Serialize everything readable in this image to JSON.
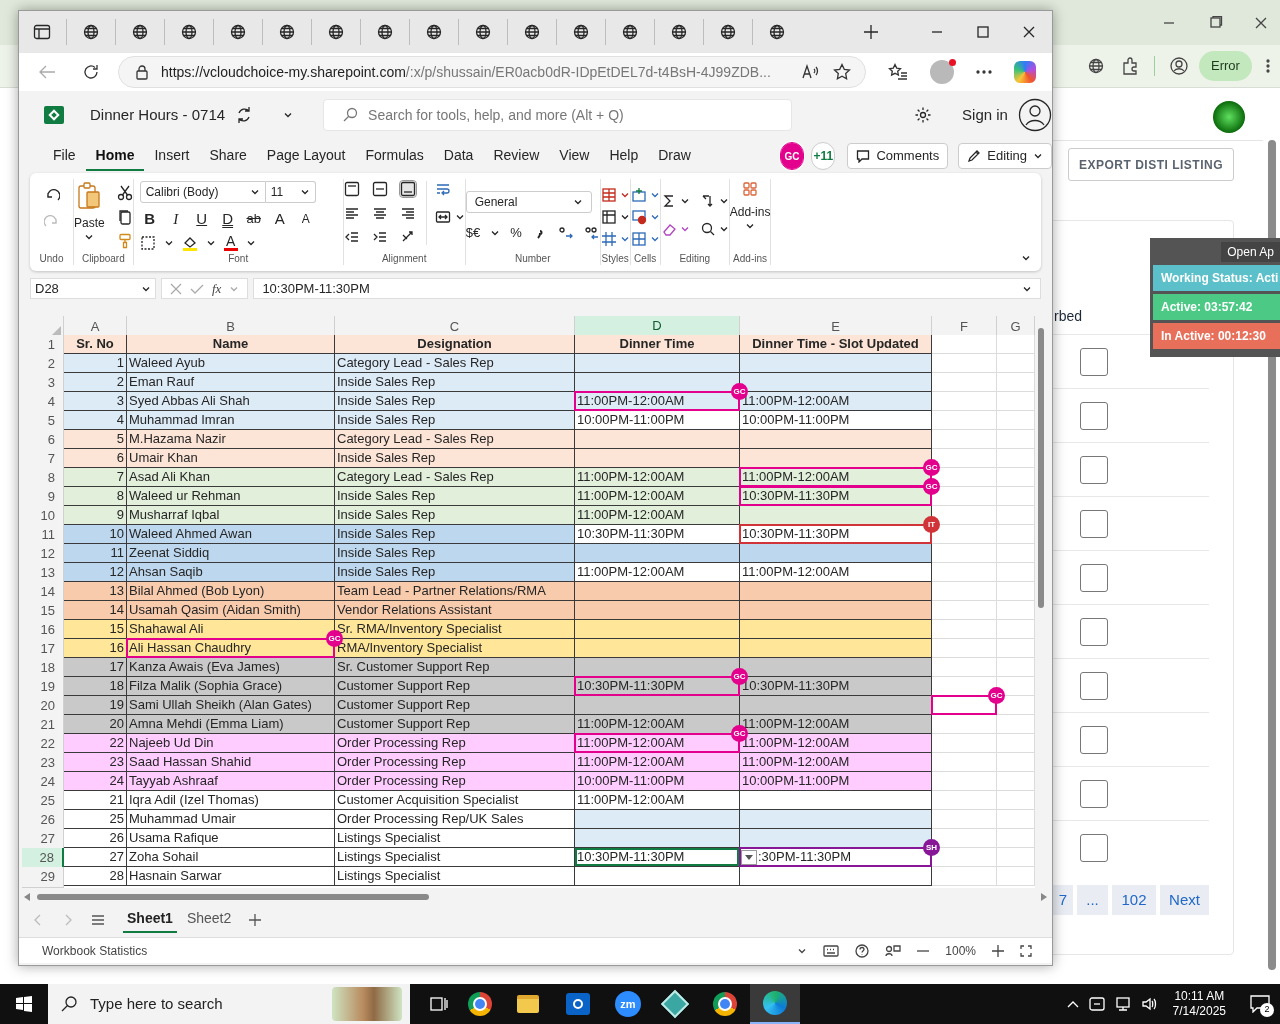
{
  "background_browser": {
    "profile_button": "Error",
    "export_button": "EXPORT DISTI LISTING",
    "column_header": "rbed",
    "checkboxes": [
      {
        "checked": false
      },
      {
        "checked": false
      },
      {
        "checked": false
      },
      {
        "checked": false
      },
      {
        "checked": false
      },
      {
        "checked": false
      },
      {
        "checked": false
      },
      {
        "checked": false
      },
      {
        "checked": false
      },
      {
        "checked": false
      }
    ],
    "pagination": [
      "7",
      "...",
      "102",
      "Next"
    ]
  },
  "status_widget": {
    "title": "Open Ap",
    "items": [
      {
        "text": "Working Status: Acti",
        "color": "#5bc0c9"
      },
      {
        "text": "Active: 03:57:42",
        "color": "#4cc985"
      },
      {
        "text": "In Active: 00:12:30",
        "color": "#e8705a"
      }
    ]
  },
  "edge_window": {
    "tabs": [
      {
        "kind": "page"
      },
      {
        "kind": "page"
      },
      {
        "kind": "page"
      },
      {
        "kind": "page"
      },
      {
        "kind": "page"
      },
      {
        "kind": "page"
      },
      {
        "kind": "page"
      },
      {
        "kind": "page"
      },
      {
        "kind": "page"
      },
      {
        "kind": "page"
      },
      {
        "kind": "page"
      },
      {
        "kind": "page"
      },
      {
        "kind": "page"
      },
      {
        "kind": "page"
      },
      {
        "kind": "page"
      }
    ],
    "address": {
      "host": "https://vcloudchoice-my.sharepoint.com",
      "path": "/:x/p/shussain/ER0acb0dR-IDpEtDEL7d-t4BsH-4J99ZDB..."
    }
  },
  "excel": {
    "title": "Dinner Hours - 0714",
    "search_placeholder": "Search for tools, help, and more (Alt + Q)",
    "sign_in": "Sign in",
    "menu": [
      {
        "label": "File",
        "selected": false
      },
      {
        "label": "Home",
        "selected": true
      },
      {
        "label": "Insert",
        "selected": false
      },
      {
        "label": "Share",
        "selected": false
      },
      {
        "label": "Page Layout",
        "selected": false
      },
      {
        "label": "Formulas",
        "selected": false
      },
      {
        "label": "Data",
        "selected": false
      },
      {
        "label": "Review",
        "selected": false
      },
      {
        "label": "View",
        "selected": false
      },
      {
        "label": "Help",
        "selected": false
      },
      {
        "label": "Draw",
        "selected": false
      }
    ],
    "collaborator": {
      "initials": "GC",
      "color": "#e3008c"
    },
    "more_collaborators": "+11",
    "comments": "Comments",
    "mode": "Editing",
    "ribbon": {
      "paste": "Paste",
      "font": "Calibri (Body)",
      "size": "11",
      "font_buttons": [
        "B",
        "I",
        "U",
        "D",
        "ab",
        "A",
        "A"
      ],
      "font_color": "A",
      "number_format": "General",
      "currency": "$€",
      "percent": "%",
      "addins": "Add-ins",
      "groups": [
        "Undo",
        "Clipboard",
        "Font",
        "Alignment",
        "Number",
        "Styles",
        "Cells",
        "Editing",
        "Add-ins"
      ]
    },
    "formula_bar": {
      "name_box": "D28",
      "function_label": "fx",
      "value": "10:30PM-11:30PM"
    },
    "columns": [
      {
        "label": "A",
        "selected": false
      },
      {
        "label": "B",
        "selected": false
      },
      {
        "label": "C",
        "selected": false
      },
      {
        "label": "D",
        "selected": true
      },
      {
        "label": "E",
        "selected": false
      },
      {
        "label": "F",
        "selected": false
      },
      {
        "label": "G",
        "selected": false
      }
    ],
    "rows": [
      {
        "n": "1",
        "kind": "header",
        "selected": false,
        "sr": "Sr. No",
        "name": "Name",
        "designation": "Designation",
        "dinner_time": "Dinner Time",
        "slot_updated": "Dinner Time - Slot Updated",
        "color": "#fce4d6",
        "time_fill": {
          "color": "#fce4d6"
        }
      },
      {
        "n": "2",
        "kind": "data",
        "selected": false,
        "sr": "1",
        "name": "Waleed Ayub",
        "designation": "Category Lead - Sales Rep",
        "color": "#ddebf7",
        "time_fill": {
          "color": "#ddebf7"
        }
      },
      {
        "n": "3",
        "kind": "data",
        "selected": false,
        "sr": "2",
        "name": "Eman Rauf",
        "designation": "Inside Sales Rep",
        "color": "#ddebf7",
        "time_fill": {
          "color": "#ddebf7"
        }
      },
      {
        "n": "4",
        "kind": "data",
        "selected": false,
        "sr": "3",
        "name": "Syed Abbas Ali Shah",
        "designation": "Inside Sales Rep",
        "dinner_time": "11:00PM-12:00AM",
        "slot_updated": "11:00PM-12:00AM",
        "color": "#ddebf7",
        "time_fill": {
          "color": "#ddebf7"
        },
        "dinner_time_marker": {
          "initials": "GC",
          "color": "#e3008c"
        }
      },
      {
        "n": "5",
        "kind": "data",
        "selected": false,
        "sr": "4",
        "name": "Muhammad Imran",
        "designation": "Inside Sales Rep",
        "dinner_time": "10:00PM-11:00PM",
        "slot_updated": "10:00PM-11:00PM",
        "color": "#ddebf7"
      },
      {
        "n": "6",
        "kind": "data",
        "selected": false,
        "sr": "5",
        "name": "M.Hazama Nazir",
        "designation": "Category Lead - Sales Rep",
        "color": "#fce4d6",
        "time_fill": {
          "color": "#fce4d6"
        }
      },
      {
        "n": "7",
        "kind": "data",
        "selected": false,
        "sr": "6",
        "name": "Umair Khan",
        "designation": "Inside Sales Rep",
        "color": "#fce4d6",
        "time_fill": {
          "color": "#fce4d6"
        }
      },
      {
        "n": "8",
        "kind": "data",
        "selected": false,
        "sr": "7",
        "name": "Asad Ali Khan",
        "designation": "Category Lead - Sales Rep",
        "dinner_time": "11:00PM-12:00AM",
        "slot_updated": "11:00PM-12:00AM",
        "color": "#e2efda",
        "time_fill": {
          "color": "#e2efda"
        },
        "slot_updated_marker": {
          "initials": "GC",
          "color": "#e3008c"
        }
      },
      {
        "n": "9",
        "kind": "data",
        "selected": false,
        "sr": "8",
        "name": "Waleed ur Rehman",
        "designation": "Inside Sales Rep",
        "dinner_time": "11:00PM-12:00AM",
        "slot_updated": "10:30PM-11:30PM",
        "color": "#e2efda",
        "time_fill": {
          "color": "#e2efda"
        },
        "slot_updated_marker": {
          "initials": "GC",
          "color": "#e3008c"
        }
      },
      {
        "n": "10",
        "kind": "data",
        "selected": false,
        "sr": "9",
        "name": "Musharraf Iqbal",
        "designation": "Inside Sales Rep",
        "dinner_time": "11:00PM-12:00AM",
        "color": "#e2efda",
        "time_fill": {
          "color": "#e2efda"
        }
      },
      {
        "n": "11",
        "kind": "data",
        "selected": false,
        "sr": "10",
        "name": "Waleed Ahmed Awan",
        "designation": "Inside Sales Rep",
        "dinner_time": "10:30PM-11:30PM",
        "slot_updated": "10:30PM-11:30PM",
        "color": "#bdd7ee",
        "slot_updated_marker": {
          "initials": "IT",
          "color": "#d13438"
        }
      },
      {
        "n": "12",
        "kind": "data",
        "selected": false,
        "sr": "11",
        "name": "Zeenat Siddiq",
        "designation": "Inside Sales Rep",
        "color": "#bdd7ee",
        "time_fill": {
          "color": "#bdd7ee"
        }
      },
      {
        "n": "13",
        "kind": "data",
        "selected": false,
        "sr": "12",
        "name": "Ahsan Saqib",
        "designation": "Inside Sales Rep",
        "dinner_time": "11:00PM-12:00AM",
        "slot_updated": "11:00PM-12:00AM",
        "color": "#bdd7ee"
      },
      {
        "n": "14",
        "kind": "data",
        "selected": false,
        "sr": "13",
        "name": "Bilal Ahmed (Bob Lyon)",
        "designation": "Team Lead - Partner Relations/RMA",
        "color": "#f8cbad",
        "time_fill": {
          "color": "#f8cbad"
        }
      },
      {
        "n": "15",
        "kind": "data",
        "selected": false,
        "sr": "14",
        "name": "Usamah Qasim (Aidan Smith)",
        "designation": "Vendor Relations Assistant",
        "color": "#f8cbad",
        "time_fill": {
          "color": "#f8cbad"
        }
      },
      {
        "n": "16",
        "kind": "data",
        "selected": false,
        "sr": "15",
        "name": "Shahawal Ali",
        "designation": "Sr. RMA/Inventory Specialist",
        "color": "#ffe699",
        "time_fill": {
          "color": "#ffe699"
        }
      },
      {
        "n": "17",
        "kind": "data",
        "selected": false,
        "sr": "16",
        "name": "Ali Hassan Chaudhry",
        "designation": "RMA/Inventory Specialist",
        "color": "#ffe699",
        "time_fill": {
          "color": "#ffe699"
        },
        "name_marker": {
          "initials": "GC",
          "color": "#e3008c"
        }
      },
      {
        "n": "18",
        "kind": "data",
        "selected": false,
        "sr": "17",
        "name": "Kanza Awais (Eva James)",
        "designation": "Sr. Customer Support Rep",
        "color": "#c9c9c9",
        "time_fill": {
          "color": "#c9c9c9"
        }
      },
      {
        "n": "19",
        "kind": "data",
        "selected": false,
        "sr": "18",
        "name": "Filza Malik (Sophia Grace)",
        "designation": "Customer Support Rep",
        "dinner_time": "10:30PM-11:30PM",
        "slot_updated": "10:30PM-11:30PM",
        "color": "#c9c9c9",
        "time_fill": {
          "color": "#c9c9c9"
        },
        "dinner_time_marker": {
          "initials": "GC",
          "color": "#e3008c"
        }
      },
      {
        "n": "20",
        "kind": "data",
        "selected": false,
        "sr": "19",
        "name": "Sami Ullah Sheikh (Alan Gates)",
        "designation": "Customer Support Rep",
        "color": "#c9c9c9",
        "time_fill": {
          "color": "#c9c9c9"
        },
        "column_f_marker": {
          "initials": "GC",
          "color": "#e3008c"
        }
      },
      {
        "n": "21",
        "kind": "data",
        "selected": false,
        "sr": "20",
        "name": "Amna Mehdi (Emma Liam)",
        "designation": "Customer Support Rep",
        "dinner_time": "11:00PM-12:00AM",
        "slot_updated": "11:00PM-12:00AM",
        "color": "#c9c9c9",
        "time_fill": {
          "color": "#c9c9c9"
        }
      },
      {
        "n": "22",
        "kind": "data",
        "selected": false,
        "sr": "22",
        "name": "Najeeb Ud Din",
        "designation": "Order Processing Rep",
        "dinner_time": "11:00PM-12:00AM",
        "slot_updated": "11:00PM-12:00AM",
        "color": "#ffccff",
        "time_fill": {
          "color": "#ffccff"
        },
        "dinner_time_marker": {
          "initials": "GC",
          "color": "#e3008c"
        }
      },
      {
        "n": "23",
        "kind": "data",
        "selected": false,
        "sr": "23",
        "name": "Saad Hassan Shahid",
        "designation": "Order Processing Rep",
        "dinner_time": "11:00PM-12:00AM",
        "slot_updated": "11:00PM-12:00AM",
        "color": "#ffccff",
        "time_fill": {
          "color": "#ffccff"
        }
      },
      {
        "n": "24",
        "kind": "data",
        "selected": false,
        "sr": "24",
        "name": "Tayyab Ashraaf",
        "designation": "Order Processing Rep",
        "dinner_time": "10:00PM-11:00PM",
        "slot_updated": "10:00PM-11:00PM",
        "color": "#ffccff",
        "time_fill": {
          "color": "#ffccff"
        }
      },
      {
        "n": "25",
        "kind": "data",
        "selected": false,
        "sr": "21",
        "name": "Iqra Adil (Izel Thomas)",
        "designation": "Customer Acquisition Specialist",
        "dinner_time": "11:00PM-12:00AM"
      },
      {
        "n": "26",
        "kind": "data",
        "selected": false,
        "sr": "25",
        "name": "Muhammad Umair",
        "designation": "Order Processing Rep/UK Sales",
        "time_fill": {
          "color": "#ddebf7"
        }
      },
      {
        "n": "27",
        "kind": "data",
        "selected": false,
        "sr": "26",
        "name": "Usama Rafique",
        "designation": "Listings Specialist",
        "time_fill": {
          "color": "#ddebf7"
        }
      },
      {
        "n": "28",
        "kind": "data",
        "selected": true,
        "sr": "27",
        "name": "Zoha Sohail",
        "designation": "Listings Specialist",
        "dinner_time": "10:30PM-11:30PM",
        "slot_updated": ":30PM-11:30PM",
        "dropdown": true,
        "slot_updated_marker": {
          "initials": "SH",
          "color": "#881798"
        }
      },
      {
        "n": "29",
        "kind": "data",
        "selected": false,
        "sr": "28",
        "name": "Hasnain Sarwar",
        "designation": "Listings Specialist"
      }
    ],
    "sheet_tabs": [
      {
        "label": "Sheet1",
        "selected": true
      },
      {
        "label": "Sheet2",
        "selected": false
      }
    ],
    "status_bar": {
      "left": "Workbook Statistics",
      "zoom": "100%"
    }
  },
  "taskbar": {
    "search_placeholder": "Type here to search",
    "zoom_app_label": "zm",
    "time": "10:11 AM",
    "date": "7/14/2025",
    "notifications": "2"
  }
}
